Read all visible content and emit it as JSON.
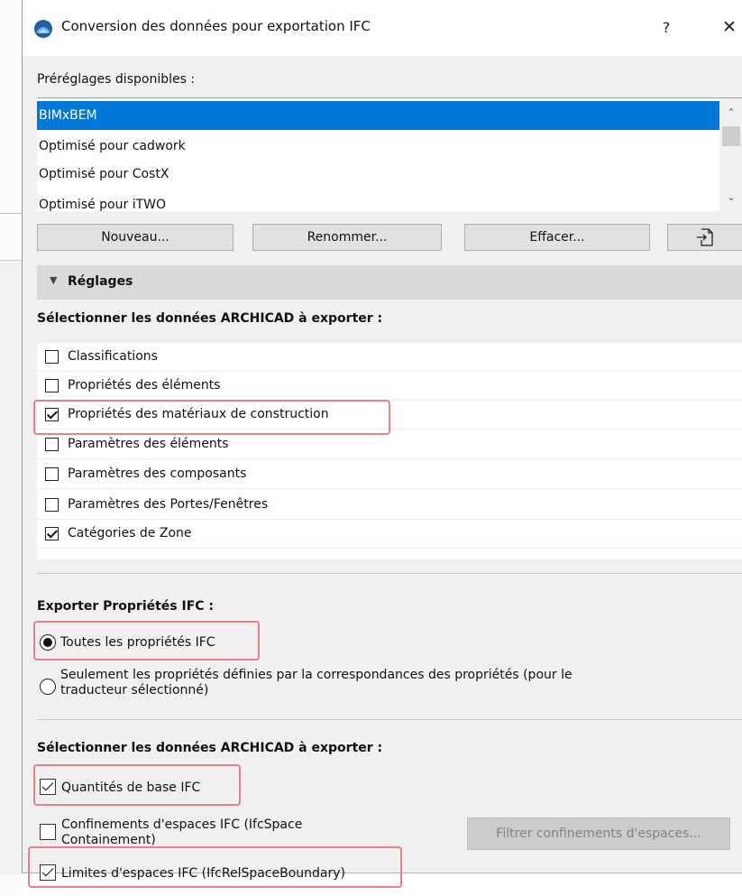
{
  "window": {
    "title": "Conversion des données pour exportation IFC",
    "help_label": "?",
    "close_label": "✕"
  },
  "presets": {
    "label": "Préréglages disponibles :",
    "items": [
      {
        "label": "BIMxBEM",
        "selected": true
      },
      {
        "label": "Optimisé pour cadwork",
        "selected": false
      },
      {
        "label": "Optimisé pour CostX",
        "selected": false
      },
      {
        "label": "Optimisé pour iTWO",
        "selected": false
      }
    ]
  },
  "buttons": {
    "new_label": "Nouveau...",
    "rename_label": "Renommer...",
    "delete_label": "Effacer...",
    "import_icon": "import-icon"
  },
  "settings": {
    "header_label": "Réglages"
  },
  "archicad_data": {
    "label": "Sélectionner les données ARCHICAD à exporter :",
    "items": [
      {
        "label": "Classifications",
        "checked": false
      },
      {
        "label": "Propriétés des éléments",
        "checked": false
      },
      {
        "label": "Propriétés des matériaux de construction",
        "checked": true
      },
      {
        "label": "Paramètres des éléments",
        "checked": false
      },
      {
        "label": "Paramètres des composants",
        "checked": false
      },
      {
        "label": "Paramètres des Portes/Fenêtres",
        "checked": false
      },
      {
        "label": "Catégories de Zone",
        "checked": true
      }
    ]
  },
  "ifc_properties": {
    "label": "Exporter Propriétés IFC :",
    "all_label": "Toutes les propriétés IFC",
    "only_label_line1": "Seulement les propriétés définies par la correspondances des propriétés (pour le",
    "only_label_line2": "traducteur sélectionné)",
    "selected": "all"
  },
  "archicad_data2": {
    "label": "Sélectionner les données ARCHICAD à exporter :",
    "base_quantities_label": "Quantités de base IFC",
    "base_quantities_checked": true,
    "space_containment_line1": "Confinements d'espaces IFC (IfcSpace",
    "space_containment_line2": "Containement)",
    "space_containment_checked": false,
    "filter_button_label": "Filtrer confinements d'espaces...",
    "space_boundaries_label": "Limites d'espaces IFC (IfcRelSpaceBoundary)",
    "space_boundaries_checked": true
  },
  "colors": {
    "selection": "#0078d7",
    "highlight": "#e8808a"
  }
}
